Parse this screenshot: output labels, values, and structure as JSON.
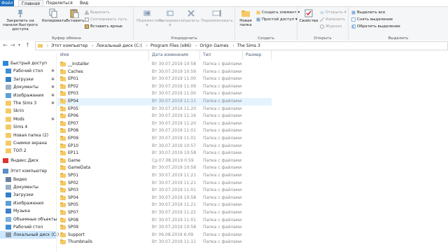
{
  "tabs": [
    "Файл",
    "Главная",
    "Поделиться",
    "Вид"
  ],
  "ribbon": {
    "clipboard": {
      "pin": "Закрепить на панели быстрого доступа",
      "copy": "Копировать",
      "paste": "Вставить",
      "cut": "Вырезать",
      "copy_path": "Скопировать путь",
      "paste_shortcut": "Вставить ярлык",
      "label": "Буфер обмена"
    },
    "organize": {
      "move": "Переместить в",
      "copy": "Копировать в",
      "delete": "Удалить",
      "rename": "Переименовать",
      "label": "Упорядочить"
    },
    "new": {
      "new_folder": "Новая папка",
      "new_item": "Создать элемент",
      "easy_access": "Простой доступ",
      "label": "Создать"
    },
    "open": {
      "properties": "Свойства",
      "open": "Открыть",
      "edit": "Изменить",
      "history": "Журнал",
      "label": "Открыть"
    },
    "select": {
      "select_all": "Выделить все",
      "select_none": "Снять выделение",
      "invert": "Обратить выделение",
      "label": "Выделить"
    }
  },
  "address": {
    "crumbs": [
      "Этот компьютер",
      "Локальный диск (C:)",
      "Program Files (x86)",
      "Origin Games",
      "The Sims 3"
    ]
  },
  "sidebar": {
    "items": [
      {
        "label": "Быстрый доступ",
        "icon": "star-icon",
        "pinned": false
      },
      {
        "label": "Рабочий стол",
        "icon": "desktop-icon",
        "pinned": true
      },
      {
        "label": "Загрузки",
        "icon": "download-icon",
        "pinned": true
      },
      {
        "label": "Документы",
        "icon": "documents-icon",
        "pinned": true
      },
      {
        "label": "Изображения",
        "icon": "pictures-icon",
        "pinned": true
      },
      {
        "label": "The Sims 3",
        "icon": "folder-icon",
        "pinned": true
      },
      {
        "label": "Skrin",
        "icon": "folder-icon",
        "pinned": false
      },
      {
        "label": "Mods",
        "icon": "folder-icon",
        "pinned": true
      },
      {
        "label": "Sims 4",
        "icon": "folder-icon",
        "pinned": false
      },
      {
        "label": "Новая папка (2)",
        "icon": "folder-icon",
        "pinned": false
      },
      {
        "label": "Снимки экрана",
        "icon": "folder-icon",
        "pinned": false
      },
      {
        "label": "ТОП 2",
        "icon": "folder-icon",
        "pinned": false
      },
      {
        "label": "Яндекс.Диск",
        "icon": "cloud-icon",
        "pinned": false
      },
      {
        "label": "Этот компьютер",
        "icon": "computer-icon",
        "pinned": false
      },
      {
        "label": "Видео",
        "icon": "video-icon",
        "pinned": false
      },
      {
        "label": "Документы",
        "icon": "documents-icon",
        "pinned": false
      },
      {
        "label": "Загрузки",
        "icon": "download-icon",
        "pinned": false
      },
      {
        "label": "Изображения",
        "icon": "pictures-icon",
        "pinned": false
      },
      {
        "label": "Музыка",
        "icon": "music-icon",
        "pinned": false
      },
      {
        "label": "Объемные объекты",
        "icon": "3d-objects-icon",
        "pinned": false
      },
      {
        "label": "Рабочий стол",
        "icon": "desktop-icon",
        "pinned": false
      },
      {
        "label": "Локальный диск (C:)",
        "icon": "drive-icon",
        "pinned": false
      }
    ]
  },
  "columns": [
    "Имя",
    "Дата изменения",
    "Тип",
    "Размер"
  ],
  "files": [
    {
      "name": "__Installer",
      "date": "Вт 30.07.2019 10:58",
      "type": "Папка с файлами"
    },
    {
      "name": "Caches",
      "date": "Вт 30.07.2019 10:59",
      "type": "Папка с файлами"
    },
    {
      "name": "EP01",
      "date": "Вт 30.07.2019 11:00",
      "type": "Папка с файлами"
    },
    {
      "name": "EP02",
      "date": "Вт 30.07.2019 11:09",
      "type": "Папка с файлами"
    },
    {
      "name": "EP03",
      "date": "Вт 30.07.2019 11:00",
      "type": "Папка с файлами"
    },
    {
      "name": "EP04",
      "date": "Вт 30.07.2019 11:11",
      "type": "Папка с файлами"
    },
    {
      "name": "EP05",
      "date": "Вт 30.07.2019 11:20",
      "type": "Папка с файлами"
    },
    {
      "name": "EP06",
      "date": "Вт 30.07.2019 11:16",
      "type": "Папка с файлами"
    },
    {
      "name": "EP07",
      "date": "Вт 30.07.2019 11:20",
      "type": "Папка с файлами"
    },
    {
      "name": "EP08",
      "date": "Вт 30.07.2019 11:01",
      "type": "Папка с файлами"
    },
    {
      "name": "EP09",
      "date": "Вт 30.07.2019 11:01",
      "type": "Папка с файлами"
    },
    {
      "name": "EP10",
      "date": "Вт 30.07.2019 10:57",
      "type": "Папка с файлами"
    },
    {
      "name": "EP11",
      "date": "Вт 30.07.2019 10:58",
      "type": "Папка с файлами"
    },
    {
      "name": "Game",
      "date": "Ср 07.08.2019 0:59",
      "type": "Папка с файлами"
    },
    {
      "name": "GameData",
      "date": "Вт 30.07.2019 10:58",
      "type": "Папка с файлами"
    },
    {
      "name": "SP01",
      "date": "Вт 30.07.2019 11:21",
      "type": "Папка с файлами"
    },
    {
      "name": "SP02",
      "date": "Вт 30.07.2019 11:21",
      "type": "Папка с файлами"
    },
    {
      "name": "SP03",
      "date": "Вт 30.07.2019 11:01",
      "type": "Папка с файлами"
    },
    {
      "name": "SP04",
      "date": "Вт 30.07.2019 10:58",
      "type": "Папка с файлами"
    },
    {
      "name": "SP05",
      "date": "Вт 30.07.2019 11:21",
      "type": "Папка с файлами"
    },
    {
      "name": "SP07",
      "date": "Вт 30.07.2019 11:22",
      "type": "Папка с файлами"
    },
    {
      "name": "SP08",
      "date": "Вт 30.07.2019 11:01",
      "type": "Папка с файлами"
    },
    {
      "name": "SP09",
      "date": "Вт 30.07.2019 10:58",
      "type": "Папка с файлами"
    },
    {
      "name": "Support",
      "date": "Вт 06.08.2019 6:09",
      "type": "Папка с файлами"
    },
    {
      "name": "Thumbnails",
      "date": "Вт 30.07.2019 11:11",
      "type": "Папка с файлами"
    }
  ],
  "hover_index": 5,
  "selected_sidebar_index": 21,
  "colors": {
    "accent": "#1e6fc0",
    "folder": "#f5c964",
    "hover": "#e5f3ff",
    "selected": "#cce8ff"
  }
}
